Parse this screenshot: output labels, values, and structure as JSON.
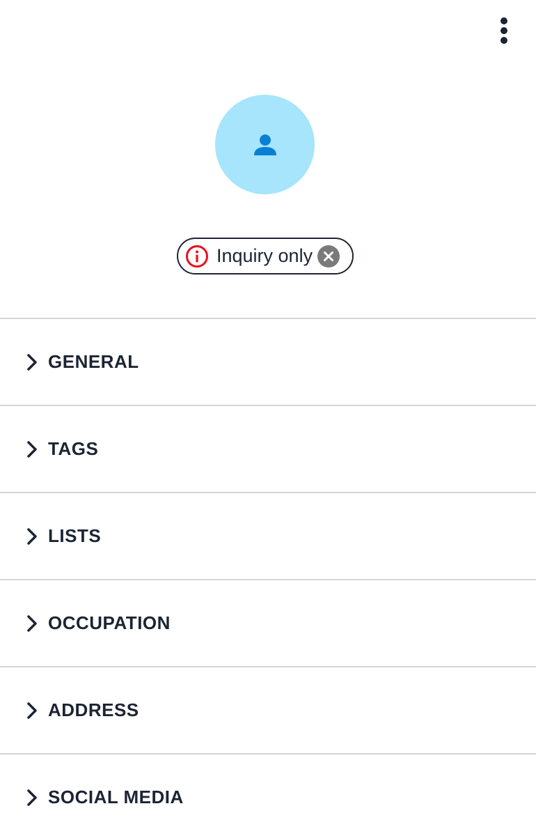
{
  "header": {
    "menu_icon": "more-vertical-icon"
  },
  "profile": {
    "avatar_icon": "person-icon",
    "avatar_bg": "#a6e5fc",
    "avatar_icon_color": "#0a7fd6"
  },
  "status_chip": {
    "label": "Inquiry only",
    "info_icon": "info-circle-icon",
    "info_color": "#e8101c",
    "remove_icon": "close-circle-icon",
    "remove_color": "#7a7a7a"
  },
  "sections": [
    {
      "label": "GENERAL"
    },
    {
      "label": "TAGS"
    },
    {
      "label": "LISTS"
    },
    {
      "label": "OCCUPATION"
    },
    {
      "label": "ADDRESS"
    },
    {
      "label": "SOCIAL MEDIA"
    }
  ]
}
